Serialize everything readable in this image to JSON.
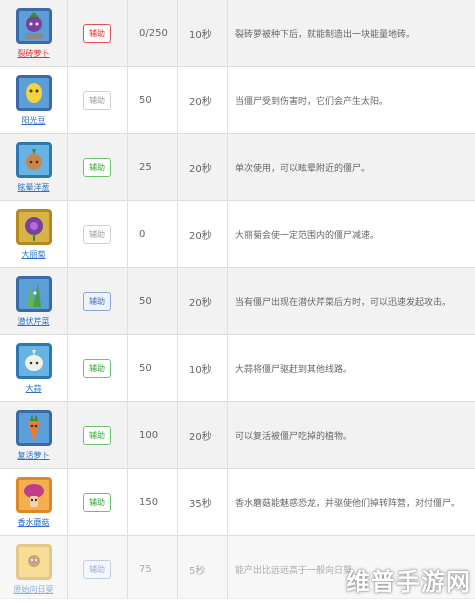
{
  "rows": [
    {
      "name": "裂砖萝卜",
      "type": "辅助",
      "cost": "0/250",
      "cooldown": "10秒",
      "desc": "裂砖萝被种下后，就能制造出一块能量地砖。",
      "icon": "radish-plant-icon"
    },
    {
      "name": "阳光豆",
      "type": "辅助",
      "cost": "50",
      "cooldown": "20秒",
      "desc": "当僵尸受到伤害时，它们会产生太阳。",
      "icon": "sun-bean-icon"
    },
    {
      "name": "眩晕洋葱",
      "type": "辅助",
      "cost": "25",
      "cooldown": "20秒",
      "desc": "单次使用，可以眩晕附近的僵尸。",
      "icon": "onion-plant-icon"
    },
    {
      "name": "大丽菊",
      "type": "辅助",
      "cost": "0",
      "cooldown": "20秒",
      "desc": "大丽菊会使一定范围内的僵尸减速。",
      "icon": "dahlia-plant-icon"
    },
    {
      "name": "潜伏芹菜",
      "type": "辅助",
      "cost": "50",
      "cooldown": "20秒",
      "desc": "当有僵尸出现在潜伏芹菜后方时，可以迅速发起攻击。",
      "icon": "celery-plant-icon"
    },
    {
      "name": "大蒜",
      "type": "辅助",
      "cost": "50",
      "cooldown": "10秒",
      "desc": "大蒜将僵尸驱赶到其他线路。",
      "icon": "garlic-plant-icon"
    },
    {
      "name": "复活萝卜",
      "type": "辅助",
      "cost": "100",
      "cooldown": "20秒",
      "desc": "可以复活被僵尸吃掉的植物。",
      "icon": "carrot-plant-icon"
    },
    {
      "name": "香水蘑菇",
      "type": "辅助",
      "cost": "150",
      "cooldown": "35秒",
      "desc": "香水蘑菇能魅惑恐龙，并驱使他们掉转阵营，对付僵尸。",
      "icon": "perfume-shroom-icon"
    },
    {
      "name": "原始向日葵",
      "type": "辅助",
      "cost": "75",
      "cooldown": "5秒",
      "desc": "能产出比远远高于一般向日葵",
      "icon": "primal-sunflower-icon"
    }
  ],
  "watermark": "维普手游网"
}
